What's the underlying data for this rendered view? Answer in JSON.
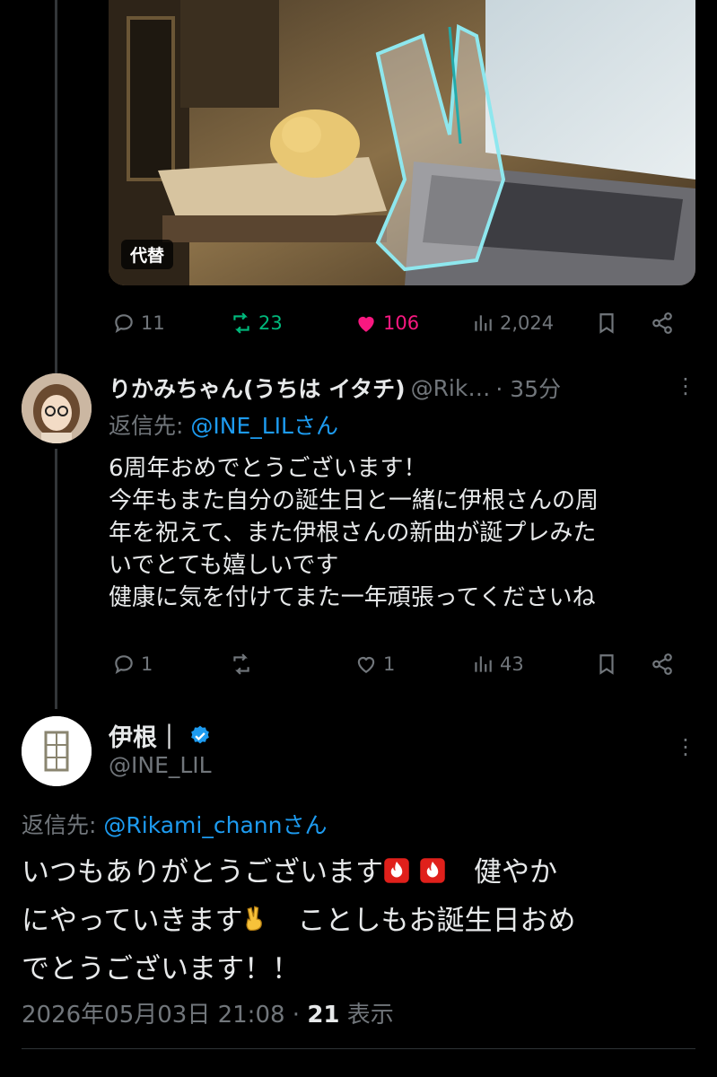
{
  "media": {
    "alt_badge": "代替"
  },
  "quoted_actions": {
    "replies": "11",
    "reposts": "23",
    "likes": "106",
    "views": "2,024"
  },
  "reply": {
    "display_name": "りかみちゃん(うちは イタチ)",
    "handle": "@Rik…",
    "time": "· 35分",
    "reply_to_prefix": "返信先: ",
    "reply_to_handle": "@INE_LILさん",
    "lines": [
      "6周年おめでとうございます！",
      "今年もまた自分の誕生日と一緒に伊根さんの周",
      "年を祝えて、また伊根さんの新曲が誕プレみた",
      "いでとても嬉しいです",
      "健康に気を付けてまた一年頑張ってくださいね"
    ],
    "actions": {
      "replies": "1",
      "reposts": "",
      "likes": "1",
      "views": "43"
    }
  },
  "main": {
    "display_name": "伊根｜",
    "handle": "@INE_LIL",
    "reply_to_prefix": "返信先: ",
    "reply_to_handle": "@Rikami_channさん",
    "text_1a": "いつもありがとうございます",
    "text_1b": "　健やか",
    "text_2a": "にやっていきます",
    "text_2b": "　ことしもお誕生日おめ",
    "text_3": "でとうございます！！",
    "date": "2026年05月03日 21:08 · ",
    "views_count": "21",
    "views_label": " 表示"
  },
  "colors": {
    "accent": "#1d9bf0",
    "repost": "#00ba7c",
    "like": "#f91880",
    "muted": "#71767b"
  }
}
